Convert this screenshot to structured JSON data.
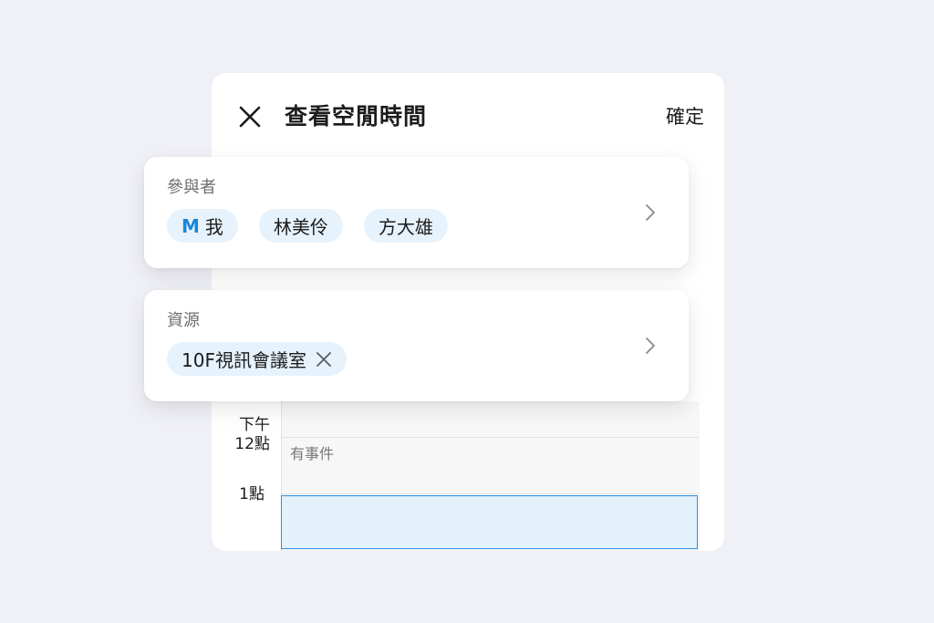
{
  "dialog": {
    "title": "查看空閒時間",
    "confirm_label": "確定"
  },
  "attendees": {
    "label": "參與者",
    "items": [
      {
        "initial": "M",
        "name": "我"
      },
      {
        "name": "林美伶"
      },
      {
        "name": "方大雄"
      }
    ]
  },
  "resources": {
    "label": "資源",
    "items": [
      {
        "name": "10F視訊會議室"
      }
    ]
  },
  "timeline": {
    "time_pm_label": "下午",
    "time_12_label": "12點",
    "time_1_label": "1點",
    "busy_text": "有事件"
  },
  "colors": {
    "accent": "#2f8fe0",
    "chip_bg": "#e6f2fc",
    "page_bg": "#f0f1f7"
  },
  "icons": {
    "close": "close-icon",
    "chevron": "chevron-right-icon",
    "remove": "remove-icon"
  }
}
